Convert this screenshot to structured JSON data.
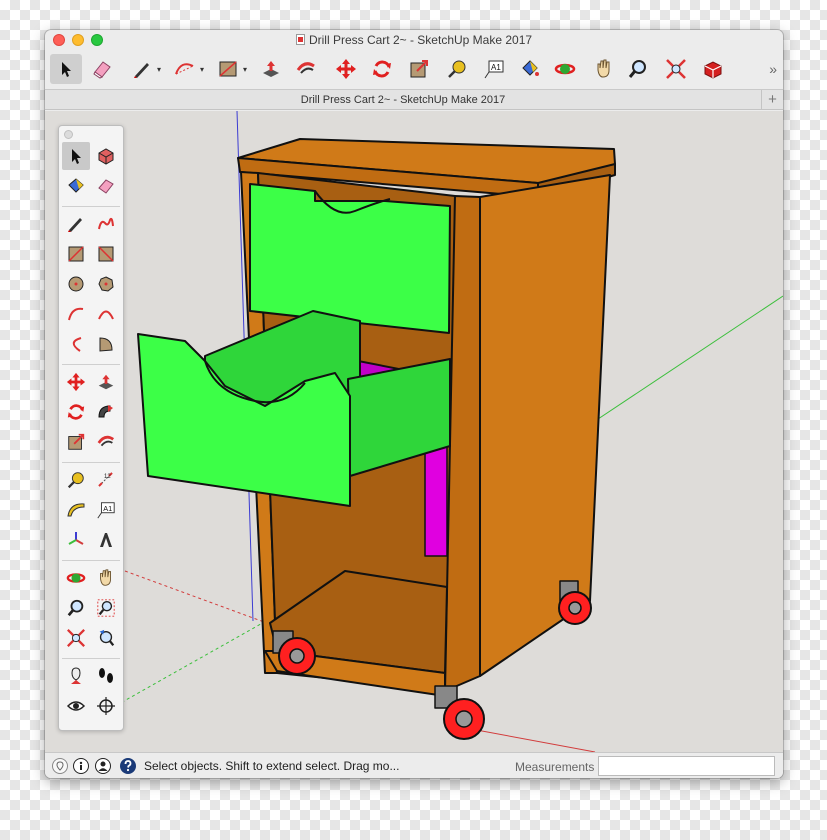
{
  "window": {
    "title": "Drill Press Cart 2~ - SketchUp Make 2017",
    "tab_title": "Drill Press Cart 2~ - SketchUp Make 2017",
    "tab_plus": "+"
  },
  "toolbar": {
    "more": "»",
    "caret": "▾",
    "tools": [
      "select",
      "eraser",
      "line",
      "arc",
      "rectangle",
      "push-pull",
      "offset",
      "move",
      "rotate",
      "scale",
      "tape-measure",
      "text",
      "paint-bucket",
      "orbit",
      "pan",
      "zoom",
      "zoom-extents",
      "3d-warehouse"
    ]
  },
  "palette": {
    "tools": [
      "select",
      "make-component",
      "paint-bucket",
      "eraser",
      "line",
      "freehand",
      "rectangle",
      "rotated-rectangle",
      "circle",
      "polygon",
      "arc",
      "two-point-arc",
      "three-point-arc",
      "pie",
      "move",
      "push-pull",
      "rotate",
      "follow-me",
      "scale",
      "offset",
      "tape-measure",
      "dimension",
      "protractor",
      "text",
      "axes",
      "3d-text",
      "orbit",
      "pan",
      "zoom",
      "zoom-window",
      "zoom-extents",
      "previous-view",
      "position-camera",
      "walk",
      "look-around",
      "section-plane"
    ]
  },
  "statusbar": {
    "message": "Select objects. Shift to extend select. Drag mo...",
    "measurements_label": "Measurements",
    "measurements_value": ""
  },
  "colors": {
    "cabinet": "#d07a18",
    "cabinet_dark": "#a85f12",
    "drawer": "#3cff47",
    "drawer_inner": "#2fd63a",
    "drawer_bottom": "#c000c8",
    "wheel": "#ff2020",
    "axis_red": "#d23c3c",
    "axis_green": "#3cbf3c",
    "axis_blue": "#3c3cd2"
  }
}
